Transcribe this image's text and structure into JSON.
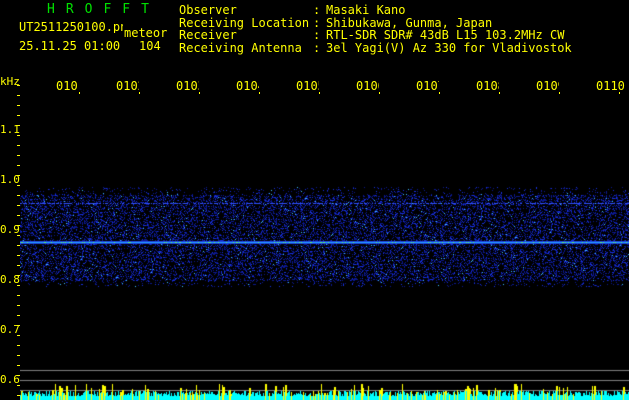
{
  "header": {
    "brand": "HROFFT",
    "filename": "UT2511250100.png",
    "type_label": "meteor",
    "datetime": "25.11.25 01:00",
    "count": "104",
    "fields": [
      {
        "label": "Observer",
        "value": "Masaki Kano"
      },
      {
        "label": "Receiving Location",
        "value": "Shibukawa, Gunma, Japan"
      },
      {
        "label": "Receiver",
        "value": "RTL-SDR SDR# 43dB L15 103.2MHz CW"
      },
      {
        "label": "Receiving Antenna",
        "value": "3el Yagi(V) Az 330 for Vladivostok"
      }
    ]
  },
  "axis": {
    "unit": "kHz",
    "y_ticks": [
      "1.1",
      "1.0",
      "0.9",
      "0.8",
      "0.7",
      "0.6"
    ],
    "x_ticks": [
      "0101",
      "0102",
      "0103",
      "0104",
      "0105",
      "0106",
      "0107",
      "0108",
      "0109",
      "0110"
    ]
  },
  "colors": {
    "text": "#ffff00",
    "brand": "#00e000",
    "signal": "#2040ff",
    "meter_cyan": "#00ffff",
    "meter_yellow": "#ffff00"
  }
}
